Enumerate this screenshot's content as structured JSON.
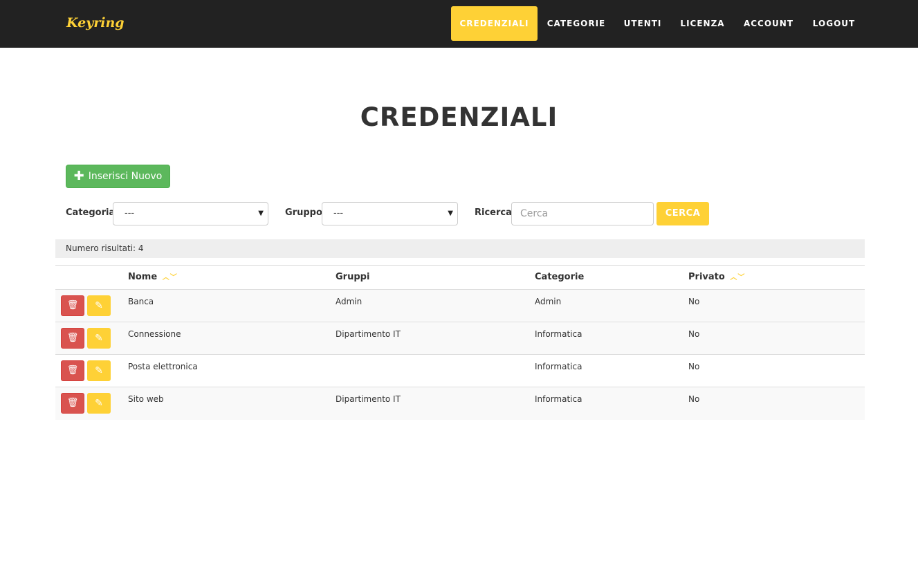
{
  "brand": "Keyring",
  "nav": [
    {
      "label": "CREDENZIALI",
      "active": true
    },
    {
      "label": "CATEGORIE",
      "active": false
    },
    {
      "label": "UTENTI",
      "active": false
    },
    {
      "label": "LICENZA",
      "active": false
    },
    {
      "label": "ACCOUNT",
      "active": false
    },
    {
      "label": "LOGOUT",
      "active": false
    }
  ],
  "page_title": "CREDENZIALI",
  "new_button_label": "Inserisci Nuovo",
  "filters": {
    "categoria_label": "Categoria",
    "categoria_value": "---",
    "gruppo_label": "Gruppo",
    "gruppo_value": "---",
    "ricerca_label": "Ricerca",
    "search_placeholder": "Cerca",
    "search_button": "CERCA"
  },
  "results_text": "Numero risultati: 4",
  "table": {
    "headers": {
      "nome": "Nome",
      "gruppi": "Gruppi",
      "categorie": "Categorie",
      "privato": "Privato"
    },
    "rows": [
      {
        "nome": "Banca",
        "gruppi": "Admin",
        "categorie": "Admin",
        "privato": "No"
      },
      {
        "nome": "Connessione",
        "gruppi": "Dipartimento IT",
        "categorie": "Informatica",
        "privato": "No"
      },
      {
        "nome": "Posta elettronica",
        "gruppi": "",
        "categorie": "Informatica",
        "privato": "No"
      },
      {
        "nome": "Sito web",
        "gruppi": "Dipartimento IT",
        "categorie": "Informatica",
        "privato": "No"
      }
    ]
  },
  "icons": {
    "delete": "trash-icon",
    "edit": "pencil-icon",
    "sort_up": "chevron-up-icon",
    "sort_down": "chevron-down-icon",
    "add": "plus-icon"
  },
  "colors": {
    "accent": "#fed136",
    "navbar": "#222222",
    "success": "#5cb85c",
    "danger": "#d9534f"
  }
}
